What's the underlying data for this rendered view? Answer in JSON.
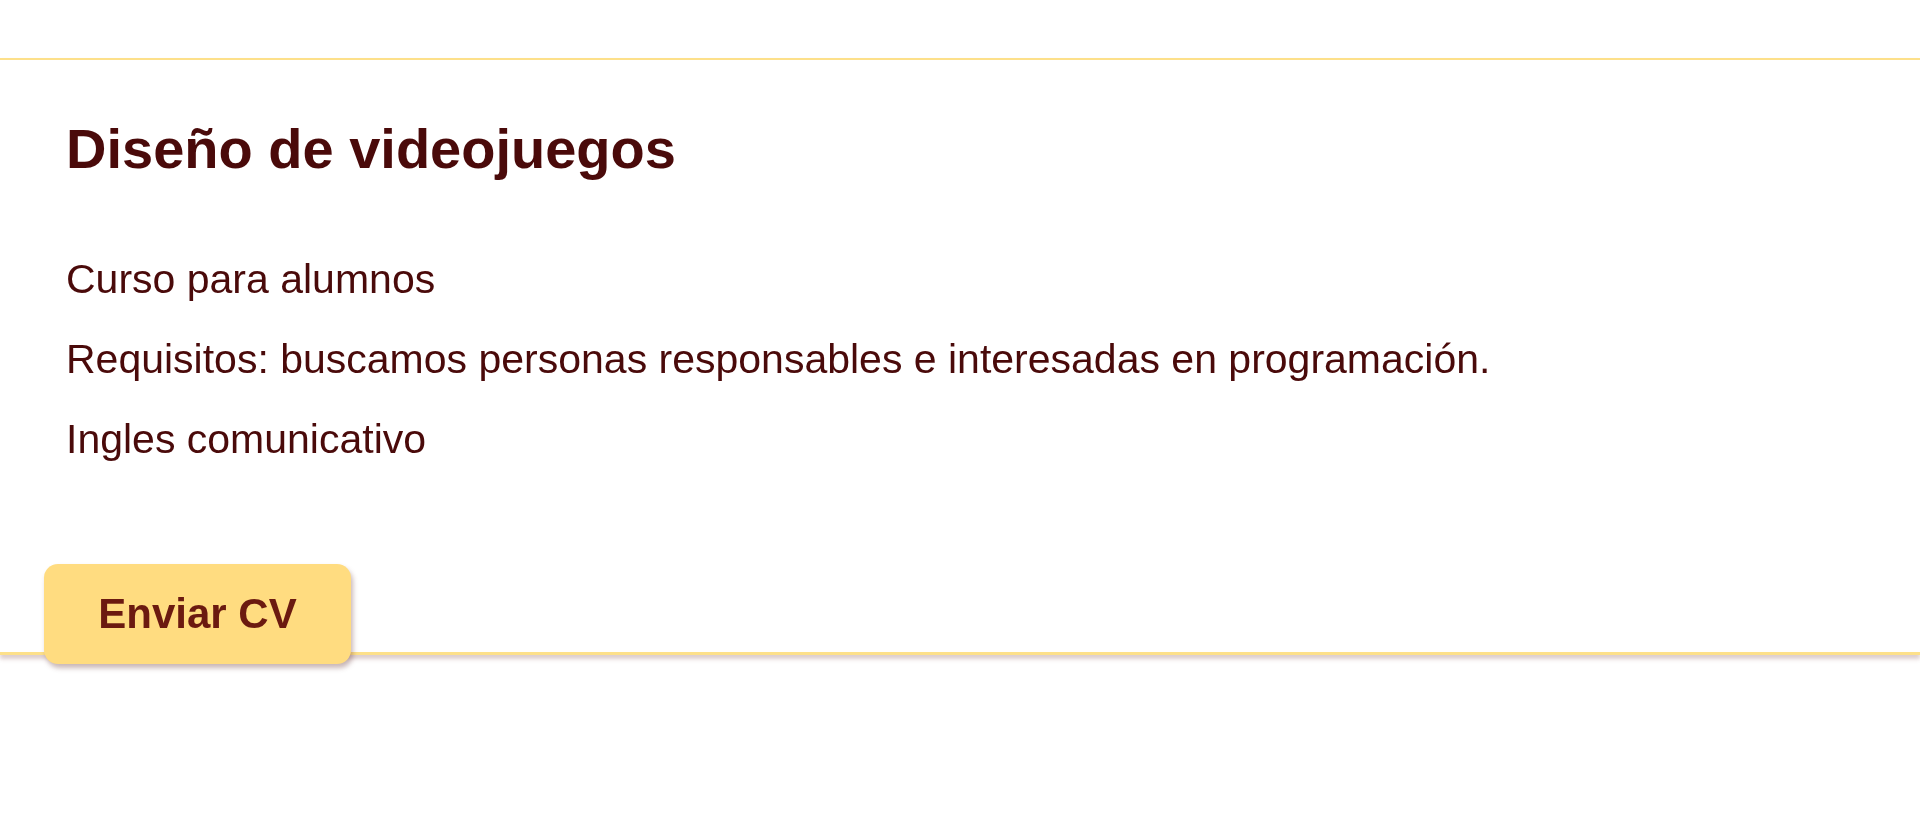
{
  "card": {
    "title": "Diseño de videojuegos",
    "lines": [
      "Curso para alumnos",
      "Requisitos: buscamos personas responsables e interesadas en programación.",
      "Ingles comunicativo"
    ],
    "button": "Enviar CV"
  }
}
